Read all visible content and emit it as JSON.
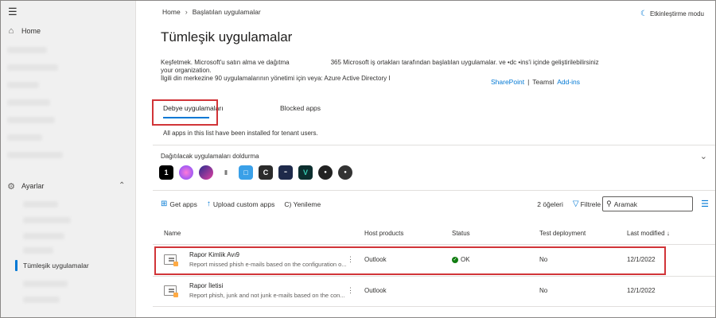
{
  "sidebar": {
    "home_label": "Home",
    "settings_label": "Ayarlar",
    "active_item_label": "Tümleşik uygulamalar"
  },
  "breadcrumb": {
    "home": "Home",
    "current": "Başlatılan uygulamalar"
  },
  "mode_toggle": "Etkinleştirme modu",
  "page_title": "Tümleşik uygulamalar",
  "description": {
    "line1_a": "Keşfetmek. Microsoft'u  satın alma  ve dağıtma",
    "line1_b": "365 Microsoft iş ortakları tarafından başlatılan uygulamalar. ve •dc •ins'i içinde geliştirilebilirsiniz",
    "line2": "your organization.",
    "line3": "İlgili  din merkezine 90 uygulamalarının yönetimi  için veya: Azure Active Directory I"
  },
  "desc_links": {
    "sharepoint": "SharePoint",
    "separator": "|",
    "teams": "Teamsl",
    "addins": "Add-ins"
  },
  "tabs": {
    "deployed": "Debye uygulamaları",
    "blocked": "Blocked apps"
  },
  "tab_note": "All apps in this list have been installed for tenant users.",
  "distribution": {
    "title": "Dağıtılacak uygulamaları doldurma"
  },
  "toolbar": {
    "get_apps": "Get apps",
    "upload": "Upload custom apps",
    "refresh": "C) Yenileme",
    "count": "2 öğeleri",
    "filter": "Filtrele",
    "search_value": "Aramak"
  },
  "table": {
    "headers": {
      "name": "Name",
      "host": "Host products",
      "status": "Status",
      "test": "Test deployment",
      "modified": "Last modified"
    },
    "rows": [
      {
        "name": "Rapor Kimlik Avı9",
        "description": "Report missed phish e-mails based on the configuration o...",
        "host": "Outlook",
        "status": "OK",
        "test": "No",
        "modified": "12/1/2022"
      },
      {
        "name": "Rapor İletisi",
        "description": "Report phish, junk and not junk e-mails based on the con...",
        "host": "Outlook",
        "status": "",
        "test": "No",
        "modified": "12/1/2022"
      }
    ]
  }
}
